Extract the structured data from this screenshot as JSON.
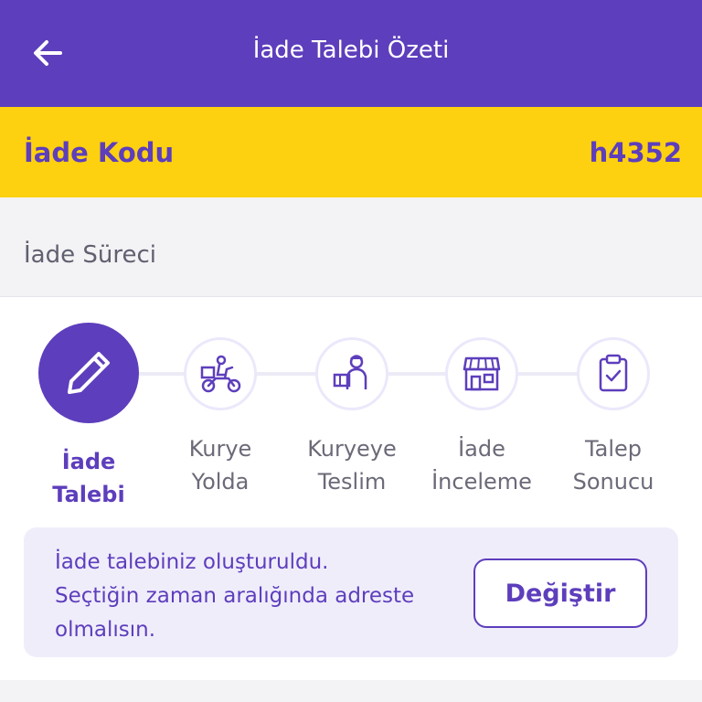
{
  "header": {
    "title": "İade Talebi Özeti",
    "back_icon": "arrow-left-icon"
  },
  "return_code": {
    "label": "İade Kodu",
    "value": "h4352"
  },
  "process": {
    "title": "İade Süreci",
    "steps": [
      {
        "line1": "İade",
        "line2": "Talebi",
        "icon": "pencil-icon",
        "active": true
      },
      {
        "line1": "Kurye",
        "line2": "Yolda",
        "icon": "scooter-courier-icon",
        "active": false
      },
      {
        "line1": "Kuryeye",
        "line2": "Teslim",
        "icon": "courier-package-icon",
        "active": false
      },
      {
        "line1": "İade",
        "line2": "İnceleme",
        "icon": "store-icon",
        "active": false
      },
      {
        "line1": "Talep",
        "line2": "Sonucu",
        "icon": "clipboard-check-icon",
        "active": false
      }
    ]
  },
  "info": {
    "line1": "İade talebiniz oluşturuldu.",
    "line2": "Seçtiğin zaman aralığında adreste",
    "line3": "olmalısın.",
    "button_label": "Değiştir"
  },
  "colors": {
    "primary": "#5d3ebc",
    "accent_yellow": "#fdd10f",
    "info_bg": "#f0edfb"
  }
}
